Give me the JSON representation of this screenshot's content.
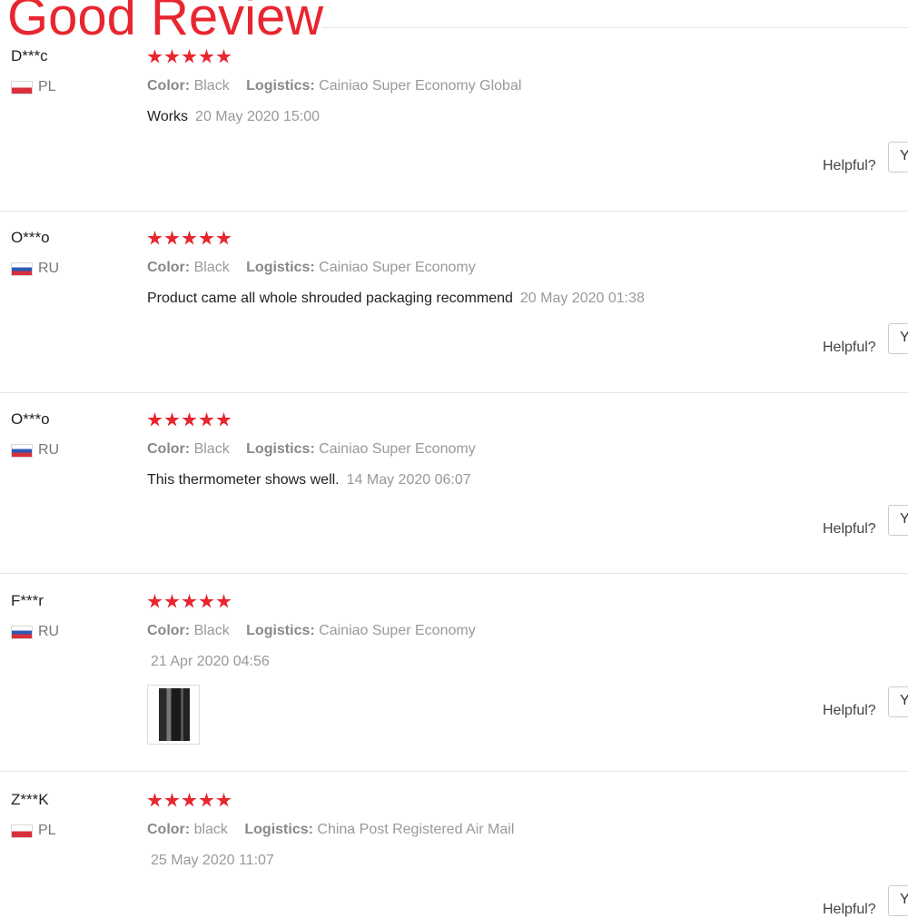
{
  "banner": "Good Review",
  "labels": {
    "color": "Color:",
    "logistics": "Logistics:",
    "helpful": "Helpful?",
    "yes_button": "Y"
  },
  "rating_color": "#e8262f",
  "reviews": [
    {
      "user": "D***c",
      "country": "PL",
      "flag_icon": "poland-flag-icon",
      "rating": 5,
      "color": "Black",
      "logistics": "Cainiao Super Economy Global",
      "text": "Works",
      "date": "20 May 2020 15:00"
    },
    {
      "user": "O***o",
      "country": "RU",
      "flag_icon": "russia-flag-icon",
      "rating": 5,
      "color": "Black",
      "logistics": "Cainiao Super Economy",
      "text": "Product came all whole shrouded packaging recommend",
      "date": "20 May 2020 01:38"
    },
    {
      "user": "O***o",
      "country": "RU",
      "flag_icon": "russia-flag-icon",
      "rating": 5,
      "color": "Black",
      "logistics": "Cainiao Super Economy",
      "text": "This thermometer shows well.",
      "date": "14 May 2020 06:07"
    },
    {
      "user": "F***r",
      "country": "RU",
      "flag_icon": "russia-flag-icon",
      "rating": 5,
      "color": "Black",
      "logistics": "Cainiao Super Economy",
      "text": "",
      "date": "21 Apr 2020 04:56",
      "has_photo": true
    },
    {
      "user": "Z***K",
      "country": "PL",
      "flag_icon": "poland-flag-icon",
      "rating": 5,
      "color": "black",
      "logistics": "China Post Registered Air Mail",
      "text": "",
      "date": "25 May 2020 11:07"
    }
  ]
}
